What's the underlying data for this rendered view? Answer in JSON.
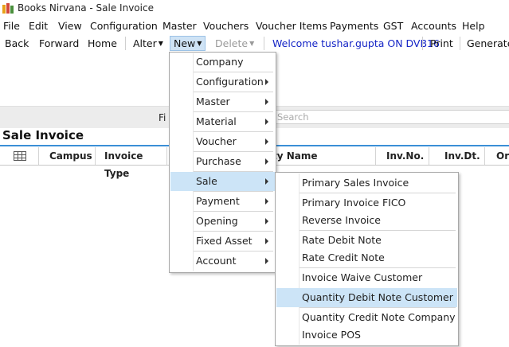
{
  "window": {
    "title": "Books Nirvana - Sale Invoice"
  },
  "menubar": {
    "items": [
      "File",
      "Edit",
      "View",
      "Configuration",
      "Master",
      "Vouchers",
      "Voucher Items",
      "Payments",
      "GST",
      "Accounts",
      "Help"
    ]
  },
  "toolbar": {
    "back": "Back",
    "forward": "Forward",
    "home": "Home",
    "alter": "Alter",
    "new": "New",
    "delete": "Delete",
    "welcome": "Welcome tushar.gupta ON DVB16",
    "print": "Print",
    "generate": "Generate F"
  },
  "filter": {
    "label": "Fi",
    "search_placeholder": "Search"
  },
  "section": {
    "title": "Sale Invoice"
  },
  "grid": {
    "columns": [
      "Campus",
      "Invoice Type",
      "ty Name",
      "Inv.No.",
      "Inv.Dt.",
      "Ori"
    ]
  },
  "new_menu": {
    "items": [
      {
        "label": "Company",
        "submenu": false
      },
      {
        "label": "Configuration",
        "submenu": true
      },
      {
        "label": "Master",
        "submenu": true
      },
      {
        "label": "Material",
        "submenu": true
      },
      {
        "label": "Voucher",
        "submenu": true
      },
      {
        "label": "Purchase",
        "submenu": true
      },
      {
        "label": "Sale",
        "submenu": true,
        "highlighted": true
      },
      {
        "label": "Payment",
        "submenu": true
      },
      {
        "label": "Opening",
        "submenu": true
      },
      {
        "label": "Fixed Asset",
        "submenu": true
      },
      {
        "label": "Account",
        "submenu": true
      }
    ]
  },
  "sale_submenu": {
    "items": [
      {
        "label": "Primary Sales Invoice"
      },
      {
        "label": "Primary Invoice FICO"
      },
      {
        "label": "Reverse Invoice"
      },
      {
        "label": "Rate Debit Note"
      },
      {
        "label": "Rate Credit Note"
      },
      {
        "label": "Invoice Waive Customer"
      },
      {
        "label": "Quantity Debit Note Customer",
        "highlighted": true
      },
      {
        "label": "Quantity Credit Note Company"
      },
      {
        "label": "Invoice POS"
      }
    ]
  },
  "colors": {
    "accent": "#3a8fd6",
    "highlight": "#cce4f7",
    "welcome": "#1525c6"
  }
}
